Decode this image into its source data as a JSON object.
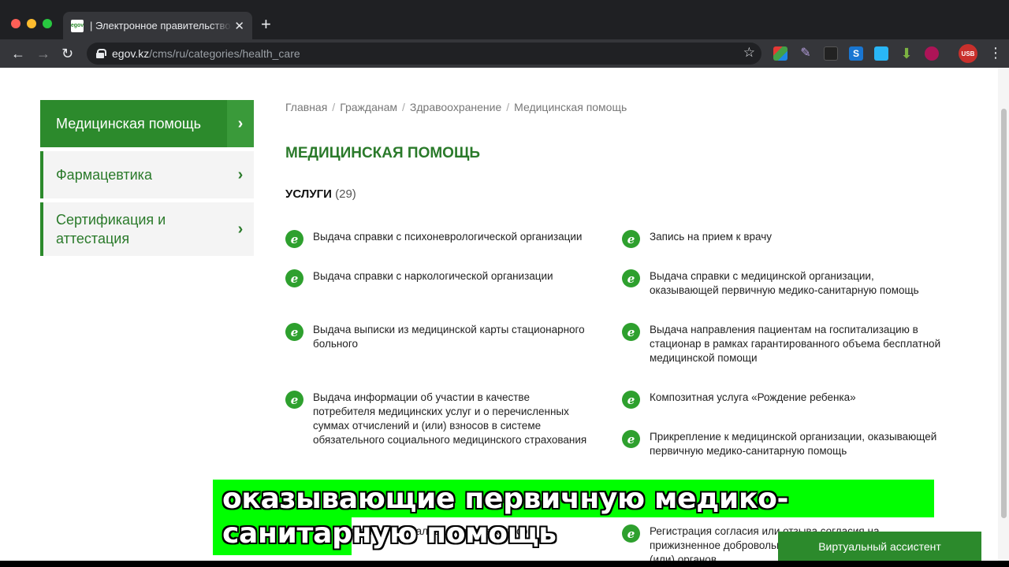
{
  "browser": {
    "tab_favicon": "egov",
    "tab_title": "| Электронное правительство",
    "close_glyph": "✕",
    "new_tab_glyph": "+",
    "url_host": "egov.kz",
    "url_path": "/cms/ru/categories/health_care",
    "profile_badge": "USB"
  },
  "sidebar": {
    "items": [
      {
        "label": "Медицинская помощь",
        "active": true
      },
      {
        "label": "Фармацевтика",
        "active": false
      },
      {
        "label": "Сертификация и аттестация",
        "active": false
      }
    ]
  },
  "breadcrumb": [
    "Главная",
    "Гражданам",
    "Здравоохранение",
    "Медицинская помощь"
  ],
  "page_title": "МЕДИЦИНСКАЯ ПОМОЩЬ",
  "services": {
    "heading": "УСЛУГИ",
    "count": "(29)",
    "icon_letter": "e",
    "left": [
      "Выдача справки с психоневрологической организации",
      "Выдача справки с наркологической организации",
      "Выдача выписки из медицинской карты стационарного больного",
      "Выдача информации об участии в качестве потребителя медицинских услуг и о перечисленных суммах отчислений и (или) взносов в системе обязательного социального медицинского страхования",
      "Предоставление инвалидам кресла-колясок"
    ],
    "right": [
      "Запись на прием к врачу",
      "Выдача справки с медицинской организации, оказывающей первичную медико-санитарную помощь",
      "Выдача направления пациентам на госпитализацию в стационар в рамках гарантированного объема бесплатной медицинской помощи",
      "Композитная услуга «Рождение ребенка»",
      "Прикрепление к медицинской организации, оказывающей первичную медико-санитарную помощь",
      "Регистрация согласия или отзыва согласия на прижизненное добровольное пожертвование тканей и (или) органов"
    ]
  },
  "caption": "оказывающие первичную медико-санитарную помощь",
  "assistant_label": "Виртуальный ассистент",
  "colors": {
    "brand_green": "#2c8a2c",
    "caption_green": "#00ff00"
  }
}
